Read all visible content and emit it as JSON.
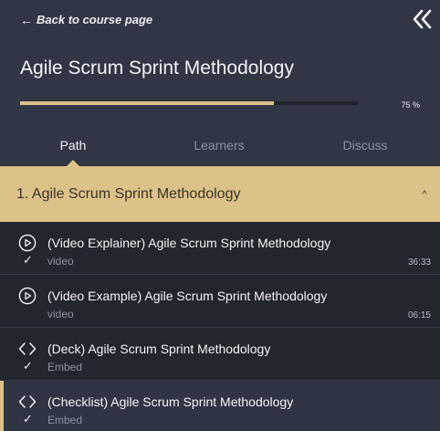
{
  "nav": {
    "back_label": "Back to course page",
    "back_arrow": "←"
  },
  "course": {
    "title": "Agile Scrum Sprint Methodology",
    "progress_percent": 75,
    "progress_label": "75 %"
  },
  "tabs": [
    {
      "label": "Path",
      "active": true
    },
    {
      "label": "Learners",
      "active": false
    },
    {
      "label": "Discuss",
      "active": false
    }
  ],
  "section": {
    "title": "1. Agile Scrum Sprint Methodology",
    "chevron": "^"
  },
  "items": [
    {
      "icon": "play-circle-icon",
      "title": "(Video Explainer) Agile Scrum Sprint Methodology",
      "type": "video",
      "duration": "36:33",
      "completed": true,
      "check": "✓"
    },
    {
      "icon": "play-circle-icon",
      "title": "(Video Example) Agile Scrum Sprint Methodology",
      "type": "video",
      "duration": "06:15",
      "completed": false,
      "check": ""
    },
    {
      "icon": "code-brackets-icon",
      "title": "(Deck) Agile Scrum Sprint Methodology",
      "type": "Embed",
      "duration": "",
      "completed": true,
      "check": "✓"
    },
    {
      "icon": "code-brackets-icon",
      "title": "(Checklist) Agile Scrum Sprint Methodology",
      "type": "Embed",
      "duration": "",
      "completed": true,
      "check": "✓",
      "active": true
    }
  ],
  "colors": {
    "background": "#2f3542",
    "item_background": "#22262f",
    "accent": "#dcc189",
    "text": "#f2f3f5",
    "muted_text": "#8c93a0"
  }
}
